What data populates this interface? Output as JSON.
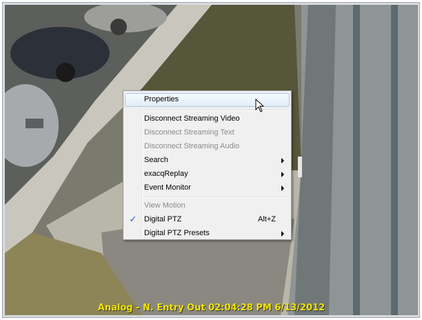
{
  "video": {
    "overlay_text": "Analog - N. Entry Out 02:04:28 PM 6/13/2012",
    "overlay_color": "#f2e200"
  },
  "context_menu": {
    "items": [
      {
        "label": "Properties",
        "enabled": true,
        "highlighted": true
      },
      {
        "label": "Disconnect Streaming Video",
        "enabled": true
      },
      {
        "label": "Disconnect Streaming Text",
        "enabled": false
      },
      {
        "label": "Disconnect Streaming Audio",
        "enabled": false
      },
      {
        "label": "Search",
        "enabled": true,
        "submenu": true
      },
      {
        "label": "exacqReplay",
        "enabled": true,
        "submenu": true
      },
      {
        "label": "Event Monitor",
        "enabled": true,
        "submenu": true
      },
      {
        "label": "View Motion",
        "enabled": false
      },
      {
        "label": "Digital PTZ",
        "enabled": true,
        "checked": true,
        "shortcut": "Alt+Z"
      },
      {
        "label": "Digital PTZ Presets",
        "enabled": true,
        "submenu": true
      }
    ],
    "check_glyph": "✓",
    "accent_color": "#1a5fb4"
  },
  "cursor": {
    "icon": "arrow-cursor-icon"
  }
}
